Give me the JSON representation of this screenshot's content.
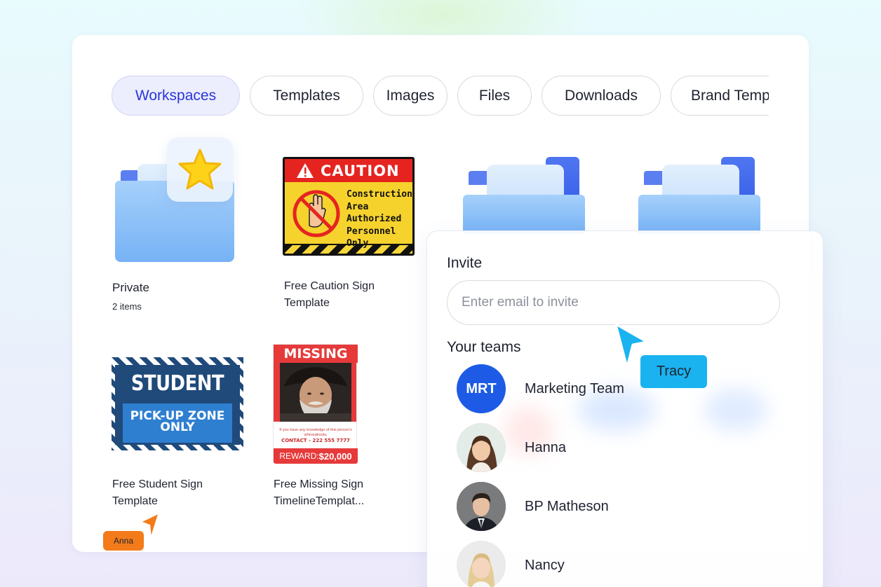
{
  "tabs": [
    {
      "label": "Workspaces",
      "active": true
    },
    {
      "label": "Templates",
      "active": false
    },
    {
      "label": "Images",
      "active": false
    },
    {
      "label": "Files",
      "active": false
    },
    {
      "label": "Downloads",
      "active": false
    },
    {
      "label": "Brand Templates",
      "active": false
    }
  ],
  "items": [
    {
      "title": "Private",
      "subtitle": "2 items",
      "icon": "star-folder-icon"
    },
    {
      "title_line1": "Free Caution Sign",
      "title_line2": "Template"
    },
    {
      "title_line1": "Free Student Sign",
      "title_line2": "Template"
    },
    {
      "title_line1": "Free Missing Sign",
      "title_line2": "TimelineTemplat..."
    }
  ],
  "caution_sign": {
    "header": "CAUTION",
    "body_lines": [
      "Construction",
      "Area",
      "Authorized",
      "Personnel Only"
    ]
  },
  "student_sign": {
    "top": "STUDENT",
    "bottom_line1": "PICK-UP ZONE",
    "bottom_line2": "ONLY"
  },
  "missing_sign": {
    "header": "MISSING",
    "small_text": "If you have any knowledge of this person's whereabouts,",
    "contact": "CONTACT - 222 555 7777",
    "reward_label": "REWARD:",
    "reward_value": "$20,000"
  },
  "cursors": {
    "anna": {
      "label": "Anna",
      "color": "#f47b1a"
    },
    "tracy": {
      "label": "Tracy",
      "color": "#1ab3f0"
    }
  },
  "invite": {
    "title": "Invite",
    "placeholder": "Enter email to invite",
    "teams_title": "Your teams",
    "members": [
      {
        "name": "Marketing Team",
        "initials": "MRT"
      },
      {
        "name": "Hanna"
      },
      {
        "name": "BP Matheson"
      },
      {
        "name": "Nancy"
      }
    ]
  },
  "colors": {
    "accent": "#2b35d8",
    "active_tab_bg": "#eceefe",
    "team_avatar": "#1d5be6"
  }
}
